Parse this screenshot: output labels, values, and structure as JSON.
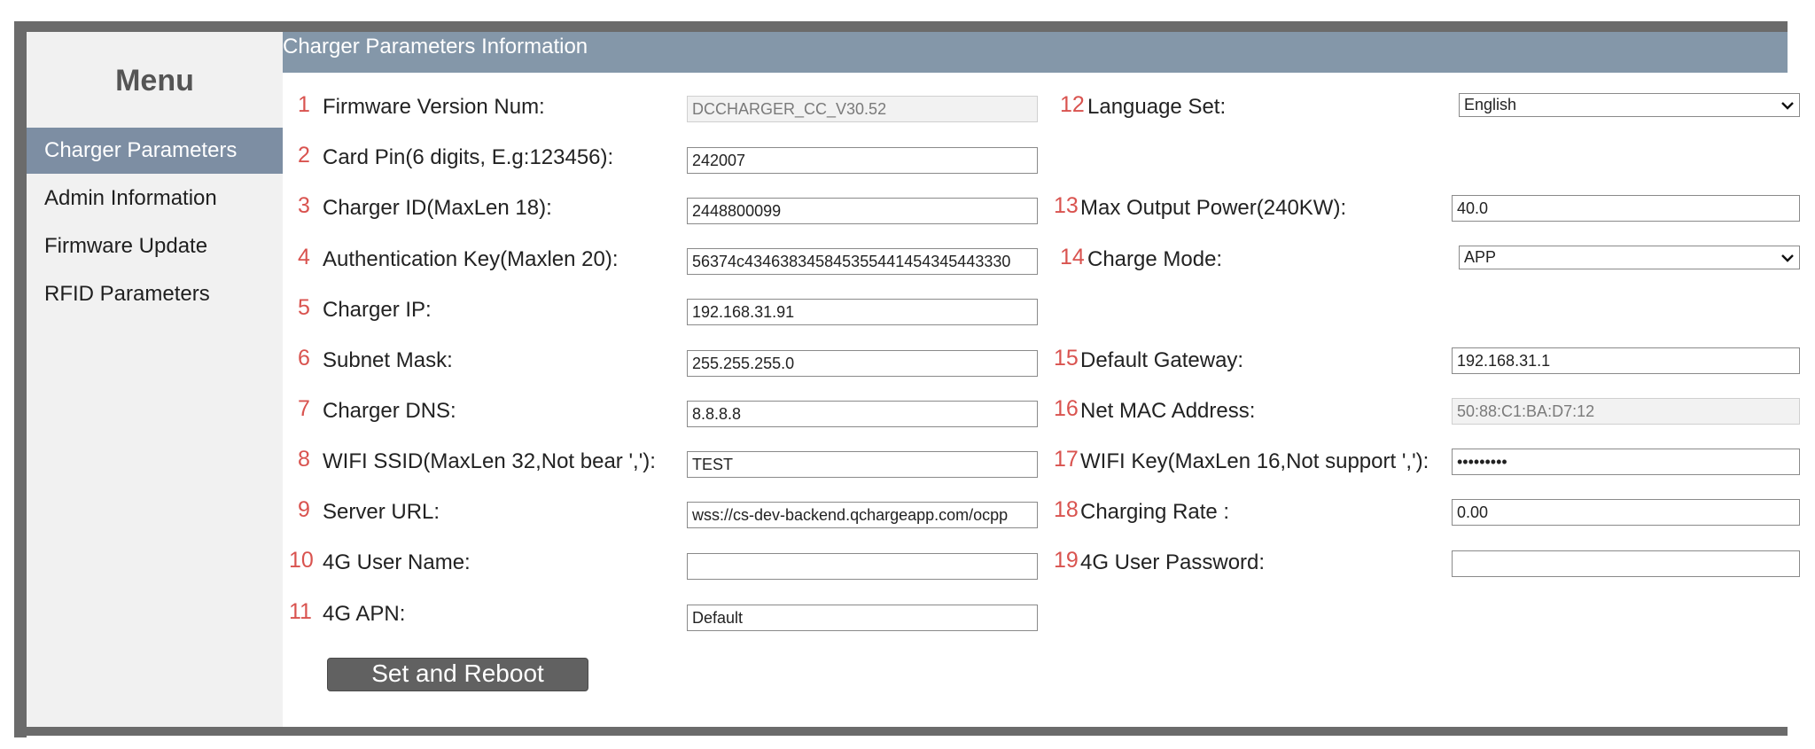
{
  "sidebar": {
    "title": "Menu",
    "items": [
      {
        "label": "Charger Parameters",
        "active": true
      },
      {
        "label": "Admin Information",
        "active": false
      },
      {
        "label": "Firmware Update",
        "active": false
      },
      {
        "label": "RFID Parameters",
        "active": false
      }
    ]
  },
  "header": {
    "title": "Charger Parameters Information"
  },
  "fields": [
    {
      "num": "1",
      "label": "Firmware Version Num:",
      "value": "DCCHARGER_CC_V30.52"
    },
    {
      "num": "2",
      "label": "Card Pin(6 digits, E.g:123456):",
      "value": "242007"
    },
    {
      "num": "3",
      "label": "Charger ID(MaxLen 18):",
      "value": "2448800099"
    },
    {
      "num": "4",
      "label": "Authentication Key(Maxlen 20):",
      "value": "56374c434638345845355441454345443330"
    },
    {
      "num": "5",
      "label": "Charger IP:",
      "value": "192.168.31.91"
    },
    {
      "num": "6",
      "label": "Subnet Mask:",
      "value": "255.255.255.0"
    },
    {
      "num": "7",
      "label": "Charger DNS:",
      "value": "8.8.8.8"
    },
    {
      "num": "8",
      "label": "WIFI SSID(MaxLen 32,Not bear ','):",
      "value": "TEST"
    },
    {
      "num": "9",
      "label": "Server URL:",
      "value": "wss://cs-dev-backend.qchargeapp.com/ocpp"
    },
    {
      "num": "10",
      "label": "4G User Name:",
      "value": ""
    },
    {
      "num": "11",
      "label": "4G APN:",
      "value": "Default"
    },
    {
      "num": "12",
      "label": "Language Set:",
      "value": "English"
    },
    {
      "num": "13",
      "label": "Max Output Power(240KW):",
      "value": "40.0"
    },
    {
      "num": "14",
      "label": "Charge Mode:",
      "value": "APP"
    },
    {
      "num": "15",
      "label": "Default Gateway:",
      "value": "192.168.31.1"
    },
    {
      "num": "16",
      "label": "Net MAC Address:",
      "value": "50:88:C1:BA:D7:12"
    },
    {
      "num": "17",
      "label": "WIFI Key(MaxLen 16,Not support ','):",
      "value": "•••••••••"
    },
    {
      "num": "18",
      "label": "Charging Rate :",
      "value": "0.00"
    },
    {
      "num": "19",
      "label": "4G User Password:",
      "value": ""
    }
  ],
  "actions": {
    "submit_label": "Set and Reboot"
  },
  "colors": {
    "frame": "#6b6b6b",
    "header": "#8497a9",
    "active_menu": "#7d8ea3",
    "number": "#d9534f",
    "button": "#616161"
  }
}
